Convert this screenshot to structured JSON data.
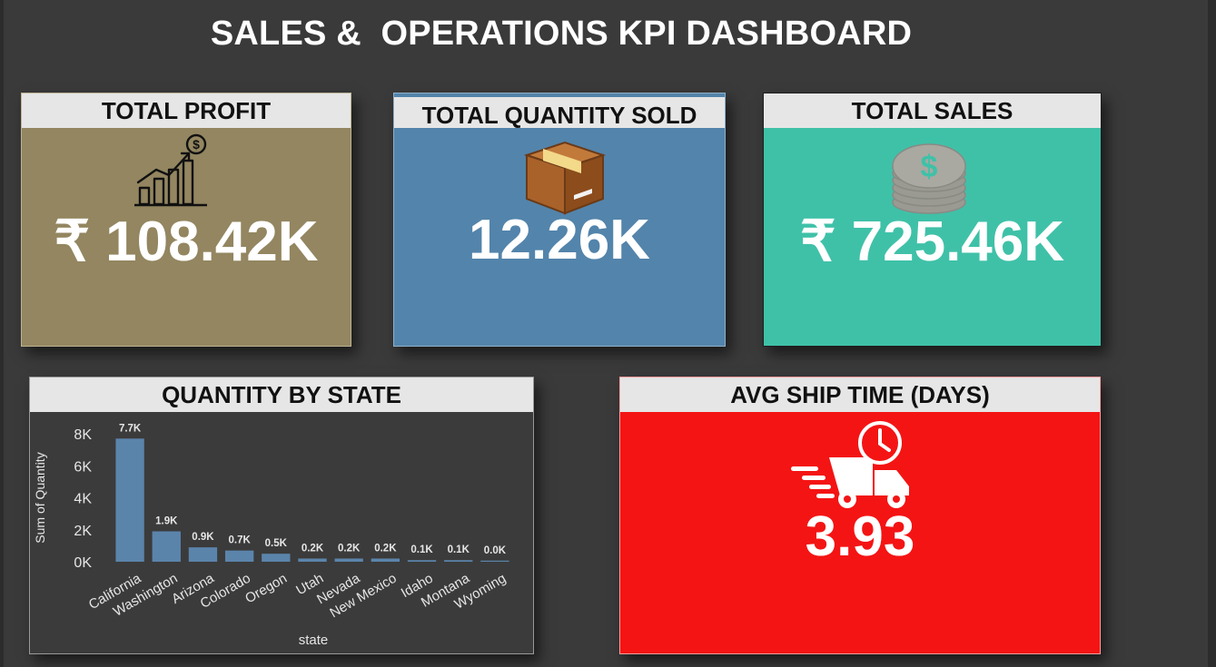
{
  "dashboard": {
    "title": "SALES &  OPERATIONS KPI DASHBOARD"
  },
  "kpis": {
    "profit": {
      "label": "TOTAL PROFIT",
      "value": "₹ 108.42K",
      "icon": "profit-growth-chart-icon"
    },
    "quantity": {
      "label": "TOTAL QUANTITY SOLD",
      "value": "12.26K",
      "icon": "package-box-icon"
    },
    "sales": {
      "label": "TOTAL SALES",
      "value": "₹ 725.46K",
      "icon": "coin-stack-icon"
    },
    "ship": {
      "label": "AVG SHIP TIME (DAYS)",
      "value": "3.93",
      "icon": "fast-delivery-truck-icon"
    }
  },
  "colors": {
    "profit_bg": "#938660",
    "quantity_bg": "#5384ab",
    "sales_bg": "#3fc1a8",
    "ship_bg": "#f41414",
    "bar": "#5b84ab",
    "background": "#3a3a3a"
  },
  "chart_panel": {
    "title": "QUANTITY BY STATE"
  },
  "chart_data": {
    "type": "bar",
    "title": "QUANTITY BY STATE",
    "xlabel": "state",
    "ylabel": "Sum of Quantity",
    "ylim": [
      0,
      8000
    ],
    "yticks": [
      0,
      2000,
      4000,
      6000,
      8000
    ],
    "ytick_labels": [
      "0K",
      "2K",
      "4K",
      "6K",
      "8K"
    ],
    "categories": [
      "California",
      "Washington",
      "Arizona",
      "Colorado",
      "Oregon",
      "Utah",
      "Nevada",
      "New Mexico",
      "Idaho",
      "Montana",
      "Wyoming"
    ],
    "values": [
      7700,
      1900,
      900,
      700,
      500,
      200,
      200,
      200,
      100,
      100,
      0
    ],
    "data_labels": [
      "7.7K",
      "1.9K",
      "0.9K",
      "0.7K",
      "0.5K",
      "0.2K",
      "0.2K",
      "0.2K",
      "0.1K",
      "0.1K",
      "0.0K"
    ],
    "grid": false,
    "legend": "none"
  }
}
